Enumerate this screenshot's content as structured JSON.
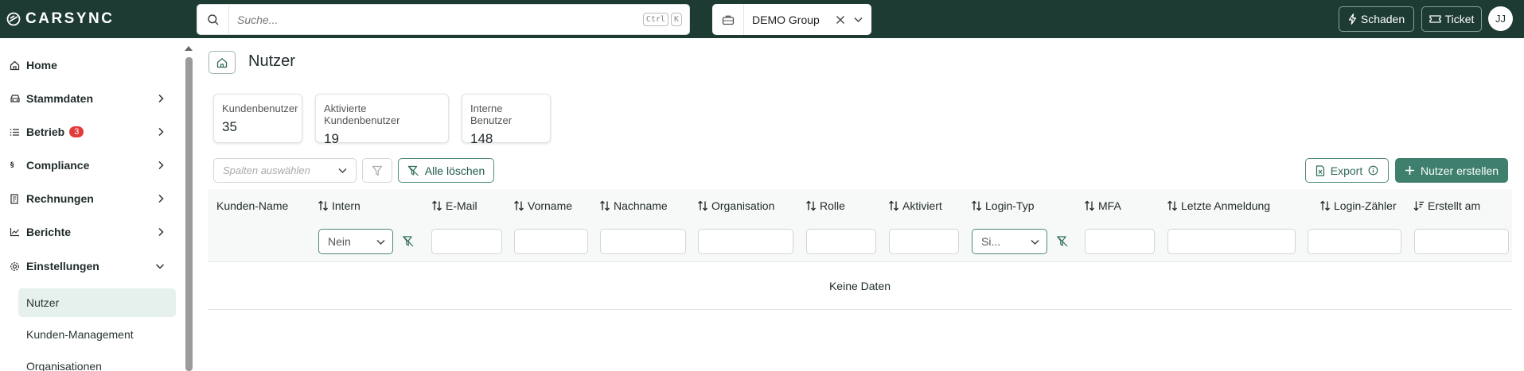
{
  "app": {
    "logo_text": "CARSYNC"
  },
  "search": {
    "placeholder": "Suche...",
    "shortcut_ctrl": "Ctrl",
    "shortcut_key": "K"
  },
  "group": {
    "label": "DEMO Group"
  },
  "topbar": {
    "damage_label": "Schaden",
    "ticket_label": "Ticket",
    "avatar_initials": "JJ"
  },
  "sidebar": {
    "items": [
      {
        "label": "Home",
        "icon": "home-icon"
      },
      {
        "label": "Stammdaten",
        "icon": "car-icon"
      },
      {
        "label": "Betrieb",
        "icon": "list-icon",
        "badge": "3"
      },
      {
        "label": "Compliance",
        "icon": "section-icon"
      },
      {
        "label": "Rechnungen",
        "icon": "invoice-icon"
      },
      {
        "label": "Berichte",
        "icon": "chart-icon"
      },
      {
        "label": "Einstellungen",
        "icon": "gear-icon"
      }
    ],
    "subitems": [
      "Nutzer",
      "Kunden-Management",
      "Organisationen"
    ]
  },
  "page": {
    "title": "Nutzer"
  },
  "stats": [
    {
      "label": "Kundenbenutzer",
      "value": "35"
    },
    {
      "label": "Aktivierte Kundenbenutzer",
      "value": "19"
    },
    {
      "label": "Interne Benutzer",
      "value": "148"
    }
  ],
  "toolbar": {
    "columns_placeholder": "Spalten auswählen",
    "clear_all_label": "Alle löschen",
    "export_label": "Export",
    "create_label": "Nutzer erstellen"
  },
  "table": {
    "columns": [
      "Kunden-Name",
      "Intern",
      "E-Mail",
      "Vorname",
      "Nachname",
      "Organisation",
      "Rolle",
      "Aktiviert",
      "Login-Typ",
      "MFA",
      "Letzte Anmeldung",
      "Login-Zähler",
      "Erstellt am"
    ],
    "filters": {
      "intern": "Nein",
      "login_typ": "Si..."
    },
    "empty_text": "Keine Daten"
  },
  "colors": {
    "topbar": "#1d3a33",
    "accent": "#3e7f6e",
    "badge": "#e23b3b",
    "active_bg": "#e6f1ee"
  }
}
